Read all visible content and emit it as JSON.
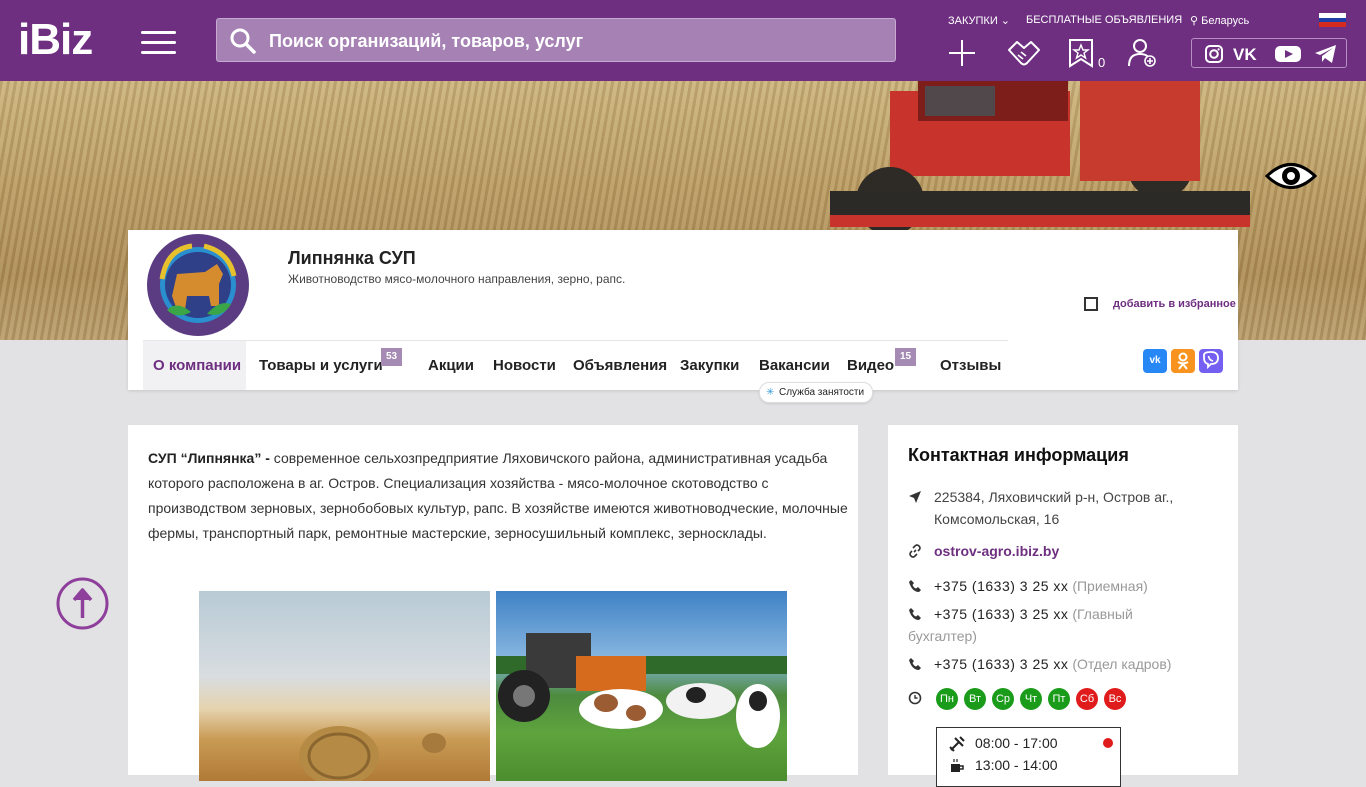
{
  "header": {
    "logo": "iBiz",
    "search_placeholder": "Поиск организаций, товаров, услуг",
    "links": {
      "purchases": "ЗАКУПКИ",
      "free_ads": "БЕСПЛАТНЫЕ ОБЪЯВЛЕНИЯ",
      "region": "Беларусь"
    },
    "favorites_count": "0",
    "icons": [
      "menu-icon",
      "search-icon",
      "plus-icon",
      "handshake-icon",
      "star-icon",
      "user-add-icon",
      "instagram-icon",
      "vk-icon",
      "youtube-icon",
      "telegram-icon",
      "ru-flag-icon",
      "eye-icon"
    ]
  },
  "company": {
    "name": "Липнянка СУП",
    "description": "Животноводство мясо-молочного направления, зерно, рапс.",
    "favorite_label": "добавить в избранное"
  },
  "tabs": [
    {
      "label": "О компании",
      "active": true
    },
    {
      "label": "Товары и услуги",
      "badge": "53"
    },
    {
      "label": "Акции"
    },
    {
      "label": "Новости"
    },
    {
      "label": "Объявления"
    },
    {
      "label": "Закупки"
    },
    {
      "label": "Вакансии"
    },
    {
      "label": "Видео",
      "badge": "15"
    },
    {
      "label": "Отзывы"
    }
  ],
  "share": [
    "vk",
    "ok",
    "viber"
  ],
  "tooltip": "Служба занятости",
  "about": {
    "lead": "СУП “Липнянка” - ",
    "text": "современное сельхозпредприятие Ляховичского района, административная усадьба которого расположена в аг. Остров.  Специализация хозяйства - мясо-молочное скотоводство с производством зерновых, зернобобовых культур, рапс.  В хозяйстве имеются животноводческие, молочные фермы, транспортный парк, ремонтные мастерские, зерносушильный комплекс, зерносклады."
  },
  "contact": {
    "title": "Контактная информация",
    "address": "225384, Ляховичский р-н, Остров аг., Комсомольская, 16",
    "website": "ostrov-agro.ibiz.by",
    "phones": [
      {
        "number": "+375 (1633) 3 25 xx",
        "note": "(Приемная)"
      },
      {
        "number": "+375 (1633) 3 25 xx",
        "note": "(Главный бухгалтер)"
      },
      {
        "number": "+375 (1633) 3 25 xx",
        "note": "(Отдел кадров)"
      }
    ],
    "days": [
      {
        "label": "Пн",
        "color": "#1a9c1a"
      },
      {
        "label": "Вт",
        "color": "#1a9c1a"
      },
      {
        "label": "Ср",
        "color": "#1a9c1a"
      },
      {
        "label": "Чт",
        "color": "#1a9c1a"
      },
      {
        "label": "Пт",
        "color": "#1a9c1a"
      },
      {
        "label": "Сб",
        "color": "#e01b1b"
      },
      {
        "label": "Вс",
        "color": "#e01b1b"
      }
    ],
    "work_hours": "08:00 - 17:00",
    "lunch_hours": "13:00 - 14:00"
  },
  "colors": {
    "brand": "#6e2f80",
    "badge": "#a58ab4",
    "open": "#1a9c1a",
    "closed": "#e01b1b"
  }
}
